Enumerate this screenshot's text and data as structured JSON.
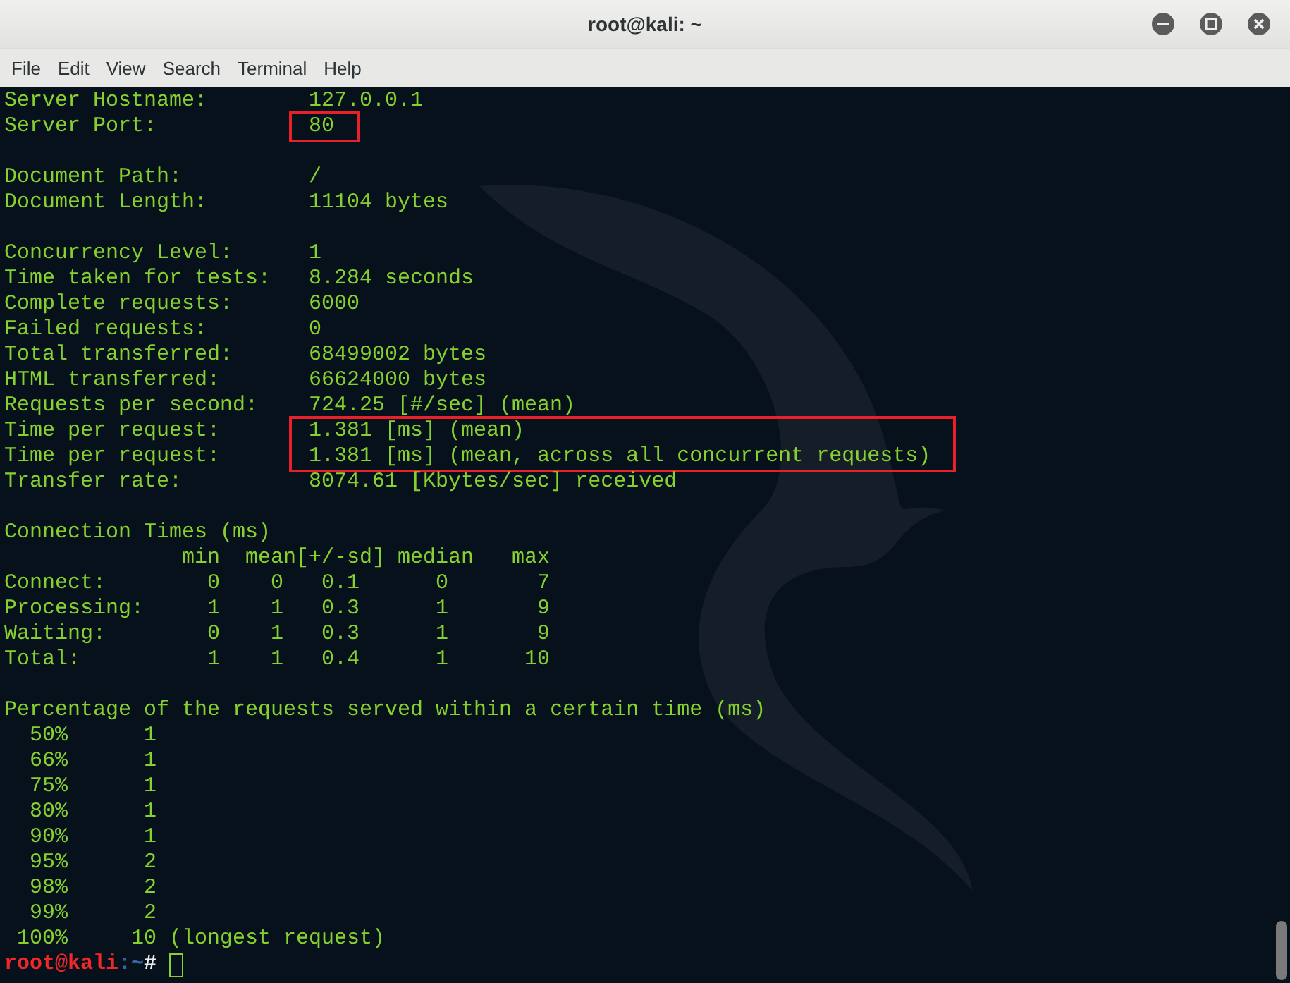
{
  "window": {
    "title": "root@kali: ~"
  },
  "menu": [
    "File",
    "Edit",
    "View",
    "Search",
    "Terminal",
    "Help"
  ],
  "sections": [
    [
      {
        "label": "Server Hostname:",
        "value": "127.0.0.1",
        "highlighted": false
      },
      {
        "label": "Server Port:",
        "value": "80",
        "highlighted": true
      }
    ],
    [
      {
        "label": "Document Path:",
        "value": "/",
        "highlighted": false
      },
      {
        "label": "Document Length:",
        "value": "11104 bytes",
        "highlighted": false
      }
    ],
    [
      {
        "label": "Concurrency Level:",
        "value": "1",
        "highlighted": false
      },
      {
        "label": "Time taken for tests:",
        "value": "8.284 seconds",
        "highlighted": false
      },
      {
        "label": "Complete requests:",
        "value": "6000",
        "highlighted": false
      },
      {
        "label": "Failed requests:",
        "value": "0",
        "highlighted": false
      },
      {
        "label": "Total transferred:",
        "value": "68499002 bytes",
        "highlighted": false
      },
      {
        "label": "HTML transferred:",
        "value": "66624000 bytes",
        "highlighted": false
      },
      {
        "label": "Requests per second:",
        "value": "724.25 [#/sec] (mean)",
        "highlighted": false
      },
      {
        "label": "Time per request:",
        "value": "1.381 [ms] (mean)",
        "highlighted": true
      },
      {
        "label": "Time per request:",
        "value": "1.381 [ms] (mean, across all concurrent requests)",
        "highlighted": true
      },
      {
        "label": "Transfer rate:",
        "value": "8074.61 [Kbytes/sec] received",
        "highlighted": false
      }
    ],
    [
      {
        "label": "Connection Times (ms)"
      },
      {
        "label": "              min  mean[+/-sd] median   max"
      },
      {
        "label": "Connect:        0    0   0.1      0       7"
      },
      {
        "label": "Processing:     1    1   0.3      1       9"
      },
      {
        "label": "Waiting:        0    1   0.3      1       9"
      },
      {
        "label": "Total:          1    1   0.4      1      10"
      }
    ],
    [
      {
        "label": "Percentage of the requests served within a certain time (ms)"
      },
      {
        "label": "  50%      1"
      },
      {
        "label": "  66%      1"
      },
      {
        "label": "  75%      1"
      },
      {
        "label": "  80%      1"
      },
      {
        "label": "  90%      1"
      },
      {
        "label": "  95%      2"
      },
      {
        "label": "  98%      2"
      },
      {
        "label": "  99%      2"
      },
      {
        "label": " 100%     10 (longest request)"
      }
    ]
  ],
  "prompt": {
    "user_host": "root@kali",
    "path": ":~",
    "symbol": "#"
  }
}
